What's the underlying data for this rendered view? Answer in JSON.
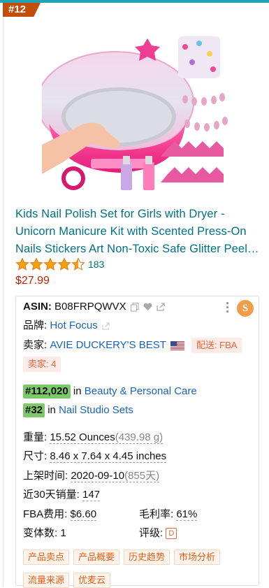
{
  "rank_badge": "#12",
  "product": {
    "title": "Kids Nail Polish Set for Girls with Dryer - Unicorn Manicure Kit with Scented Press-On Nails Stickers Art Non-Toxic Safe Glitter Peel…",
    "rating_value": 4.5,
    "rating_count": "183",
    "price": "$27.99"
  },
  "details": {
    "asin_label": "ASIN:",
    "asin": "B08FRPQWVX",
    "brand_label": "品牌:",
    "brand": "Hot Focus",
    "seller_label": "卖家:",
    "seller": "AVIE DUCKERY'S BEST",
    "fulfillment": "配送: FBA",
    "seller_count": "卖家: 4",
    "rank1_no": "#112,020",
    "rank1_in": "in",
    "rank1_cat": "Beauty & Personal Care",
    "rank2_no": "#32",
    "rank2_in": "in",
    "rank2_cat": "Nail Studio Sets",
    "weight_label": "重量:",
    "weight": "15.52 Ounces",
    "weight_g": "(439.98 g)",
    "size_label": "尺寸:",
    "size": "8.46 x 7.64 x 4.45 inches",
    "date_label": "上架时间:",
    "date": "2020-09-10",
    "days": "(855天)",
    "sales_label": "近30天销量:",
    "sales": "147",
    "fba_label": "FBA费用:",
    "fba": "$6.60",
    "margin_label": "毛利率:",
    "margin": "61%",
    "variants_label": "变体数:",
    "variants": "1",
    "grade_label": "评级:",
    "grade": "D"
  },
  "buttons": [
    "产品卖点",
    "产品概要",
    "历史趋势",
    "市场分析",
    "流量来源",
    "优麦云"
  ],
  "plugin_icon": "S",
  "colors": {
    "accent_teal": "#20a4b5",
    "badge": "#c24e0c",
    "link": "#007185",
    "price": "#b12704",
    "rank_green": "#7dc869",
    "tag_orange": "#e8643c"
  }
}
